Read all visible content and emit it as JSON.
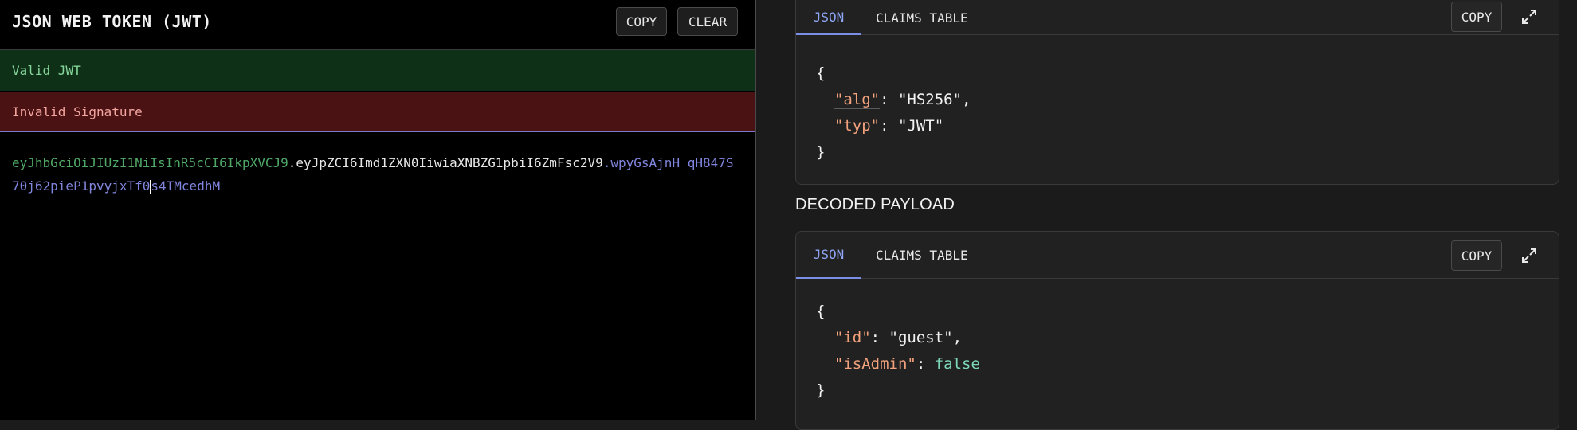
{
  "encoder": {
    "title": "JSON WEB TOKEN (JWT)",
    "copy_label": "COPY",
    "clear_label": "CLEAR",
    "status_valid": "Valid JWT",
    "status_invalid": "Invalid Signature",
    "token_header": "eyJhbGciOiJIUzI1NiIsInR5cCI6IkpXVCJ9",
    "token_payload": "eyJpZCI6Imd1ZXN0IiwiaXNBZG1pbiI6ZmFsc2V9",
    "token_signature_part1": "wpyGsAjnH_qH847S70j62pieP1pvyjxTf0",
    "token_signature_part2": "s4TMcedhM",
    "colors": {
      "header": "#4fa866",
      "payload": "#e8e8e8",
      "signature": "#8085dd",
      "valid_bg": "#0d3017",
      "invalid_bg": "#4a1212"
    }
  },
  "decoded_header": {
    "tabs": [
      "JSON",
      "CLAIMS TABLE"
    ],
    "active_tab": "JSON",
    "copy_label": "COPY",
    "expand_icon": "expand-icon",
    "json": {
      "open": "{",
      "close": "}",
      "lines": [
        {
          "key": "\"alg\"",
          "value": "\"HS256\"",
          "trail": ","
        },
        {
          "key": "\"typ\"",
          "value": "\"JWT\"",
          "trail": ""
        }
      ]
    }
  },
  "decoded_payload": {
    "section_title": "DECODED PAYLOAD",
    "tabs": [
      "JSON",
      "CLAIMS TABLE"
    ],
    "active_tab": "JSON",
    "copy_label": "COPY",
    "expand_icon": "expand-icon",
    "json": {
      "open": "{",
      "close": "}",
      "lines": [
        {
          "key": "\"id\"",
          "value": "\"guest\"",
          "trail": ","
        },
        {
          "key": "\"isAdmin\"",
          "value": "false",
          "trail": ""
        }
      ]
    }
  }
}
